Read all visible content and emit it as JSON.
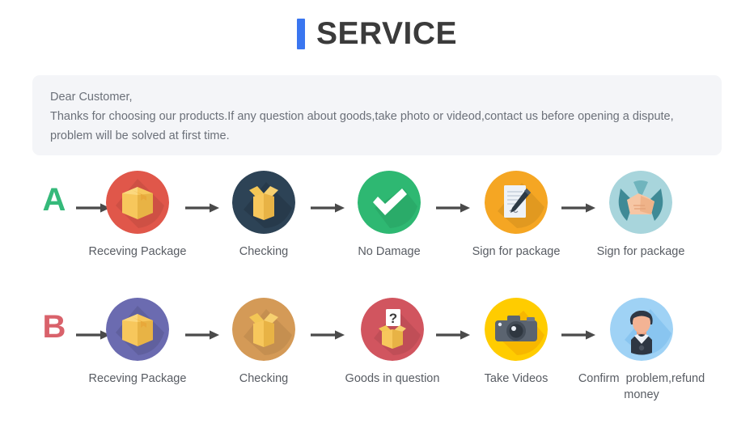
{
  "header": {
    "accent_color": "#3a76f0",
    "title": "SERVICE"
  },
  "notice": {
    "background_color": "#f4f5f8",
    "line1": "Dear Customer,",
    "line2": "Thanks for choosing our products.If any question about goods,take photo or videod,contact us before opening a dispute,",
    "line3": "problem will be solved at first time."
  },
  "rows": [
    {
      "letter": "A",
      "letter_color": "#35b97a",
      "steps": [
        {
          "label": "Receving Package",
          "icon": "package-box-icon",
          "circle_color": "#e0574a"
        },
        {
          "label": "Checking",
          "icon": "open-box-icon",
          "circle_color": "#2d4356"
        },
        {
          "label": "No Damage",
          "icon": "check-mark-icon",
          "circle_color": "#2eb872"
        },
        {
          "label": "Sign for package",
          "icon": "document-pen-icon",
          "circle_color": "#f5a623"
        },
        {
          "label": "Sign for package",
          "icon": "handshake-icon",
          "circle_color": "#a8d5dc"
        }
      ]
    },
    {
      "letter": "B",
      "letter_color": "#d9626b",
      "steps": [
        {
          "label": "Receving Package",
          "icon": "package-box-icon",
          "circle_color": "#6b6bb0"
        },
        {
          "label": "Checking",
          "icon": "open-box-icon",
          "circle_color": "#d49a57"
        },
        {
          "label": "Goods in question",
          "icon": "question-box-icon",
          "circle_color": "#d1555f"
        },
        {
          "label": "Take Videos",
          "icon": "camera-icon",
          "circle_color": "#ffcc00"
        },
        {
          "label": "Confirm  problem,refund money",
          "icon": "person-avatar-icon",
          "circle_color": "#9fd2f5"
        }
      ]
    }
  ],
  "arrow": {
    "name": "right-arrow-icon",
    "color": "#4a4a4a"
  }
}
